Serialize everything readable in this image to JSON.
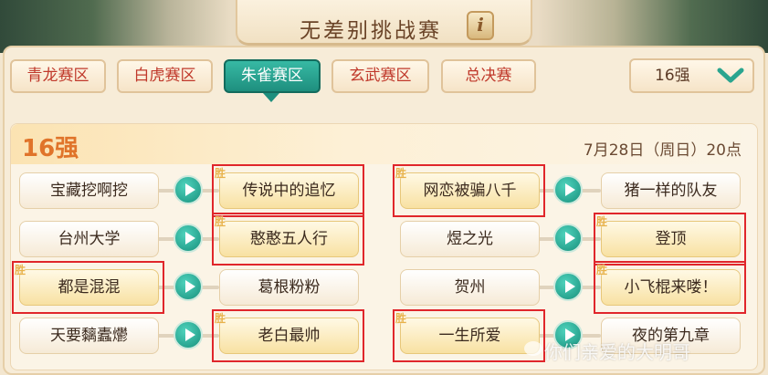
{
  "header": {
    "title": "无差别挑战赛",
    "info_icon_text": "i"
  },
  "tabs": [
    {
      "label": "青龙赛区",
      "active": false
    },
    {
      "label": "白虎赛区",
      "active": false
    },
    {
      "label": "朱雀赛区",
      "active": true
    },
    {
      "label": "玄武赛区",
      "active": false
    },
    {
      "label": "总决赛",
      "active": false
    }
  ],
  "round_selector": {
    "value": "16强",
    "icon": "chevron-down-icon"
  },
  "round": {
    "title": "16强",
    "time": "7月28日（周日）20点"
  },
  "matches": [
    {
      "left": "宝藏挖啊挖",
      "right": "传说中的追忆",
      "winner": "right"
    },
    {
      "left": "台州大学",
      "right": "憨憨五人行",
      "winner": "right"
    },
    {
      "left": "都是混混",
      "right": "葛根粉粉",
      "winner": "left"
    },
    {
      "left": "天要黐蠹爩",
      "right": "老白最帅",
      "winner": "right"
    },
    {
      "left": "网恋被骗八千",
      "right": "猪一样的队友",
      "winner": "left"
    },
    {
      "left": "煜之光",
      "right": "登顶",
      "winner": "right"
    },
    {
      "left": "贺州",
      "right": "小飞棍来喽！",
      "winner": "right"
    },
    {
      "left": "一生所爱",
      "right": "夜的第九章",
      "winner": "left"
    }
  ],
  "win_label": "胜",
  "watermark": "你们亲爱的大明哥",
  "colors": {
    "accent_teal": "#1e8f7e",
    "tab_text": "#c0392b",
    "win_outline": "#e0262b",
    "round_title": "#e0742a"
  }
}
